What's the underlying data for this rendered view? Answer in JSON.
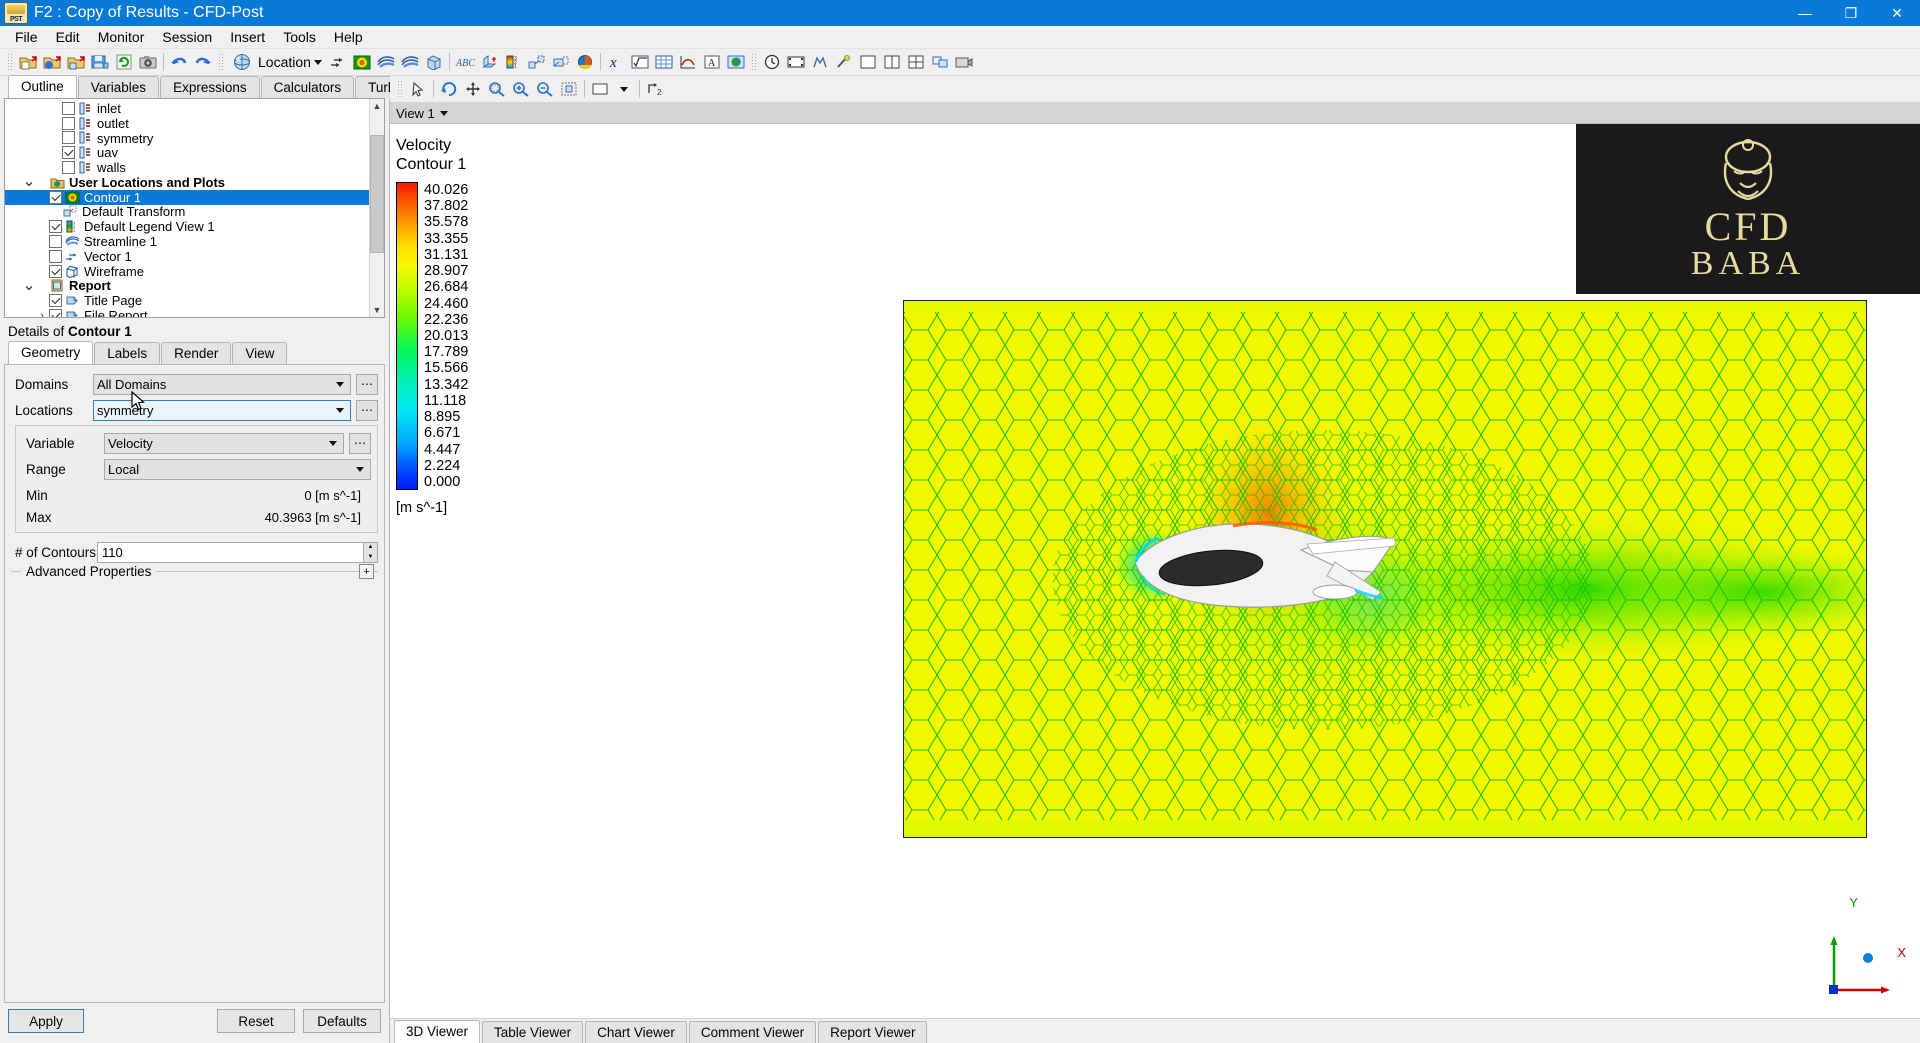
{
  "window": {
    "title": "F2 : Copy of Results - CFD-Post",
    "app_icon": "PST",
    "minimize": "—",
    "maximize": "❐",
    "close": "✕"
  },
  "menu": [
    "File",
    "Edit",
    "Monitor",
    "Session",
    "Insert",
    "Tools",
    "Help"
  ],
  "toolbar": {
    "location_label": "Location",
    "icons": [
      "open-file-icon",
      "open-results-icon",
      "load-state-icon",
      "save-state-icon",
      "refresh-icon",
      "snapshot-icon",
      "undo-icon",
      "redo-icon",
      "location-icon",
      "vector-icon",
      "contour-icon",
      "streamline-icon",
      "volume-render-icon",
      "text-icon",
      "coordinate-frame-icon",
      "legend-icon",
      "instancing-icon",
      "clip-plane-icon",
      "color-map-icon",
      "expression-icon",
      "calculator-icon",
      "table-icon",
      "chart-icon",
      "comment-icon",
      "report-icon",
      "timestep-icon",
      "animation-icon",
      "macro-icon",
      "probe-icon",
      "viewport-1-icon",
      "viewport-2-icon",
      "viewport-4-icon",
      "sync-icon",
      "camera-icon"
    ]
  },
  "view_toolbar": {
    "icons": [
      "select-icon",
      "rotate-icon",
      "pan-icon",
      "zoom-box-icon",
      "zoom-in-icon",
      "zoom-out-icon",
      "fit-view-icon",
      "viewport-layout-icon",
      "layout-caret-icon",
      "sync-camera-icon"
    ]
  },
  "outline": {
    "tabs": [
      {
        "label": "Outline",
        "active": true
      },
      {
        "label": "Variables",
        "active": false
      },
      {
        "label": "Expressions",
        "active": false
      },
      {
        "label": "Calculators",
        "active": false
      },
      {
        "label": "Turbo",
        "active": false
      }
    ],
    "tree": [
      {
        "label": "inlet",
        "indent": 3,
        "checkbox": "off",
        "icon": "boundary-icon",
        "chevron": "",
        "bold": false,
        "selected": false
      },
      {
        "label": "outlet",
        "indent": 3,
        "checkbox": "off",
        "icon": "boundary-icon",
        "chevron": "",
        "bold": false,
        "selected": false
      },
      {
        "label": "symmetry",
        "indent": 3,
        "checkbox": "off",
        "icon": "boundary-icon",
        "chevron": "",
        "bold": false,
        "selected": false
      },
      {
        "label": "uav",
        "indent": 3,
        "checkbox": "on",
        "icon": "boundary-icon",
        "chevron": "",
        "bold": false,
        "selected": false
      },
      {
        "label": "walls",
        "indent": 3,
        "checkbox": "off",
        "icon": "boundary-icon",
        "chevron": "",
        "bold": false,
        "selected": false
      },
      {
        "label": "User Locations and Plots",
        "indent": 1,
        "checkbox": "none",
        "icon": "folder-locations-icon",
        "chevron": "v",
        "bold": true,
        "selected": false
      },
      {
        "label": "Contour 1",
        "indent": 2,
        "checkbox": "on",
        "icon": "contour-icon",
        "chevron": "",
        "bold": false,
        "selected": true
      },
      {
        "label": "Default Transform",
        "indent": 2,
        "checkbox": "none",
        "icon": "transform-icon",
        "chevron": "",
        "bold": false,
        "selected": false
      },
      {
        "label": "Default Legend View 1",
        "indent": 2,
        "checkbox": "on",
        "icon": "legend-icon",
        "chevron": "",
        "bold": false,
        "selected": false
      },
      {
        "label": "Streamline 1",
        "indent": 2,
        "checkbox": "off",
        "icon": "streamline-icon",
        "chevron": "",
        "bold": false,
        "selected": false
      },
      {
        "label": "Vector 1",
        "indent": 2,
        "checkbox": "off",
        "icon": "vector-icon",
        "chevron": "",
        "bold": false,
        "selected": false
      },
      {
        "label": "Wireframe",
        "indent": 2,
        "checkbox": "on",
        "icon": "wireframe-icon",
        "chevron": "",
        "bold": false,
        "selected": false
      },
      {
        "label": "Report",
        "indent": 1,
        "checkbox": "none",
        "icon": "report-icon",
        "chevron": "v",
        "bold": true,
        "selected": false
      },
      {
        "label": "Title Page",
        "indent": 2,
        "checkbox": "on",
        "icon": "page-icon",
        "chevron": "",
        "bold": false,
        "selected": false
      },
      {
        "label": "File Report",
        "indent": 2,
        "checkbox": "on",
        "icon": "page-icon",
        "chevron": ">",
        "bold": false,
        "selected": false
      }
    ]
  },
  "details": {
    "title_prefix": "Details of ",
    "title_object": "Contour 1",
    "tabs": [
      {
        "label": "Geometry",
        "active": true
      },
      {
        "label": "Labels",
        "active": false
      },
      {
        "label": "Render",
        "active": false
      },
      {
        "label": "View",
        "active": false
      }
    ],
    "fields": {
      "domains_label": "Domains",
      "domains_value": "All Domains",
      "locations_label": "Locations",
      "locations_value": "symmetry",
      "variable_label": "Variable",
      "variable_value": "Velocity",
      "range_label": "Range",
      "range_value": "Local",
      "min_label": "Min",
      "min_value": "0 [m s^-1]",
      "max_label": "Max",
      "max_value": "40.3963 [m s^-1]",
      "contours_label": "# of Contours",
      "contours_value": "110",
      "advanced_label": "Advanced Properties",
      "advanced_toggle": "+"
    },
    "buttons": {
      "apply": "Apply",
      "reset": "Reset",
      "defaults": "Defaults"
    }
  },
  "viewer": {
    "view_name": "View 1",
    "tabs": [
      {
        "label": "3D Viewer",
        "active": true
      },
      {
        "label": "Table Viewer",
        "active": false
      },
      {
        "label": "Chart Viewer",
        "active": false
      },
      {
        "label": "Comment Viewer",
        "active": false
      },
      {
        "label": "Report Viewer",
        "active": false
      }
    ],
    "axis_x": "X",
    "axis_y": "Y"
  },
  "legend": {
    "title_line1": "Velocity",
    "title_line2": "Contour 1",
    "unit": "[m s^-1]",
    "ticks": [
      "40.026",
      "37.802",
      "35.578",
      "33.355",
      "31.131",
      "28.907",
      "26.684",
      "24.460",
      "22.236",
      "20.013",
      "17.789",
      "15.566",
      "13.342",
      "11.118",
      "8.895",
      "6.671",
      "4.447",
      "2.224",
      "0.000"
    ],
    "colors": {
      "max": "#f41c00",
      "mid": "#f6f900",
      "min": "#0019ff"
    }
  },
  "watermark": {
    "line1": "CFD",
    "line2": "BABA"
  }
}
